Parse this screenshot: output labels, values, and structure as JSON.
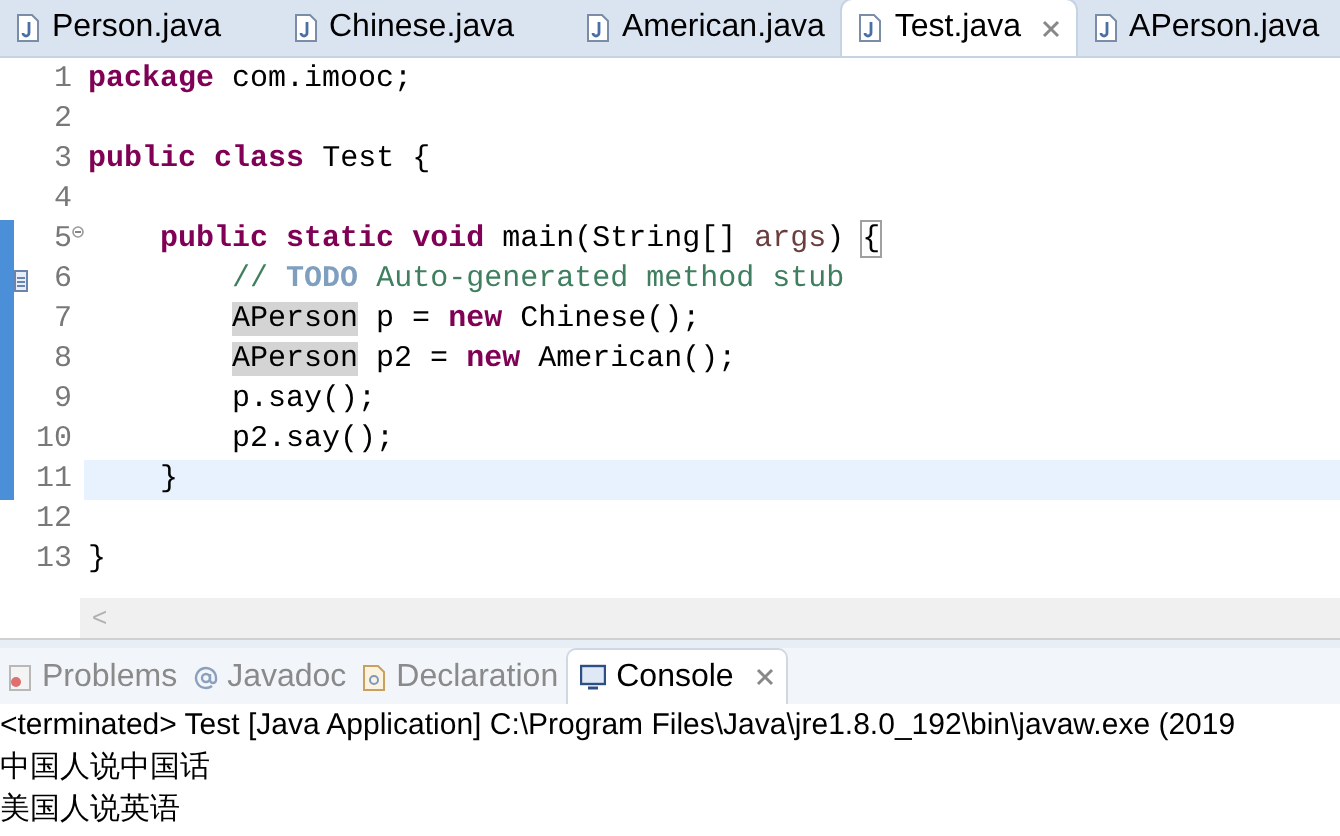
{
  "editor_tabs": [
    {
      "label": "Person.java",
      "selected": false
    },
    {
      "label": "Chinese.java",
      "selected": false
    },
    {
      "label": "American.java",
      "selected": false
    },
    {
      "label": "Test.java",
      "selected": true
    },
    {
      "label": "APerson.java",
      "selected": false
    }
  ],
  "code": [
    {
      "number": "1",
      "changed": false,
      "current": false,
      "collapsible": false,
      "task": false,
      "tokens": [
        {
          "kind": "keyword",
          "text": "package"
        },
        {
          "kind": "plain",
          "text": " com.imooc;"
        }
      ]
    },
    {
      "number": "2",
      "changed": false,
      "current": false,
      "collapsible": false,
      "task": false
    },
    {
      "number": "3",
      "changed": false,
      "current": false,
      "collapsible": false,
      "task": false,
      "tokens": [
        {
          "kind": "keyword",
          "text": "public"
        },
        {
          "kind": "keyword",
          "text": " class"
        },
        {
          "kind": "plain",
          "text": " Test {"
        }
      ]
    },
    {
      "number": "4",
      "changed": false,
      "current": false,
      "collapsible": false,
      "task": false
    },
    {
      "number": "5",
      "changed": true,
      "current": false,
      "collapsible": true,
      "task": false,
      "tokens": [
        {
          "kind": "keyword",
          "text": "    public"
        },
        {
          "kind": "keyword",
          "text": " static"
        },
        {
          "kind": "keyword",
          "text": " void"
        },
        {
          "kind": "plain",
          "text": " main(String[] "
        },
        {
          "kind": "param",
          "text": "args"
        },
        {
          "kind": "plain",
          "text": ") "
        },
        {
          "kind": "bracket",
          "text": "{"
        }
      ]
    },
    {
      "number": "6",
      "changed": true,
      "current": false,
      "collapsible": false,
      "task": true,
      "tokens": [
        {
          "kind": "comment",
          "text": "        // "
        },
        {
          "kind": "todo",
          "text": "TODO"
        },
        {
          "kind": "comment",
          "text": " Auto-generated method stub"
        }
      ]
    },
    {
      "number": "7",
      "changed": true,
      "current": false,
      "collapsible": false,
      "task": false,
      "tokens": [
        {
          "kind": "occurrence",
          "text": "        APerson"
        },
        {
          "kind": "plain",
          "text": " p = "
        },
        {
          "kind": "keyword",
          "text": "new"
        },
        {
          "kind": "plain",
          "text": " Chinese();"
        }
      ]
    },
    {
      "number": "8",
      "changed": true,
      "current": false,
      "collapsible": false,
      "task": false,
      "tokens": [
        {
          "kind": "occurrence",
          "text": "        APerson"
        },
        {
          "kind": "plain",
          "text": " p2 = "
        },
        {
          "kind": "keyword",
          "text": "new"
        },
        {
          "kind": "plain",
          "text": " American();"
        }
      ]
    },
    {
      "number": "9",
      "changed": true,
      "current": false,
      "collapsible": false,
      "task": false,
      "tokens": [
        {
          "kind": "plain",
          "text": "        p.say();"
        }
      ]
    },
    {
      "number": "10",
      "changed": true,
      "current": false,
      "collapsible": false,
      "task": false,
      "tokens": [
        {
          "kind": "plain",
          "text": "        p2.say();"
        }
      ]
    },
    {
      "number": "11",
      "changed": true,
      "current": true,
      "collapsible": false,
      "task": false,
      "tokens": [
        {
          "kind": "plain",
          "text": "    }"
        }
      ]
    },
    {
      "number": "12",
      "changed": false,
      "current": false,
      "collapsible": false,
      "task": false
    },
    {
      "number": "13",
      "changed": false,
      "current": false,
      "collapsible": false,
      "task": false,
      "tokens": [
        {
          "kind": "plain",
          "text": "}"
        }
      ]
    }
  ],
  "scroll_left": "<",
  "panel_tabs": [
    {
      "label": "Problems",
      "selected": false
    },
    {
      "label": "Javadoc",
      "selected": false
    },
    {
      "label": "Declaration",
      "selected": false
    },
    {
      "label": "Console",
      "selected": true
    }
  ],
  "console": {
    "header": "<terminated> Test [Java Application] C:\\Program Files\\Java\\jre1.8.0_192\\bin\\javaw.exe (2019",
    "output": [
      "中国人说中国话",
      "美国人说英语"
    ]
  }
}
